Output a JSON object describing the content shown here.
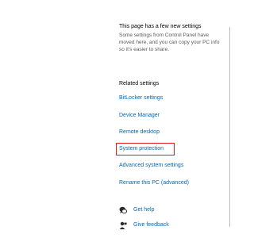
{
  "notice": {
    "title": "This page has a few new settings",
    "body": "Some settings from Control Panel have moved here, and you can copy your PC info so it's easier to share."
  },
  "related": {
    "title": "Related settings",
    "links": [
      "BitLocker settings",
      "Device Manager",
      "Remote desktop",
      "System protection",
      "Advanced system settings",
      "Rename this PC (advanced)"
    ]
  },
  "support": {
    "get_help": "Get help",
    "give_feedback": "Give feedback"
  },
  "colors": {
    "link": "#0067b8",
    "highlight": "#e01919"
  },
  "icons": {
    "help": "help-chat-icon",
    "feedback": "feedback-person-icon"
  }
}
